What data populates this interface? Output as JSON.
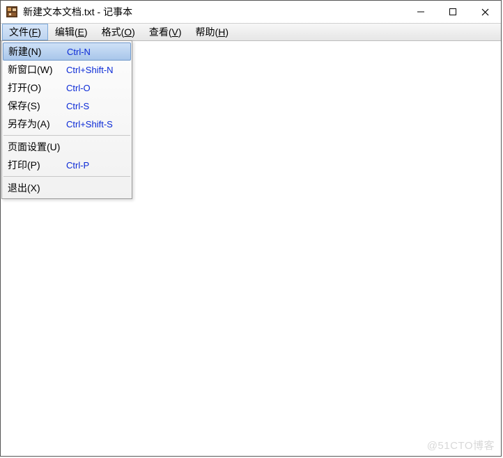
{
  "window": {
    "title": "新建文本文档.txt - 记事本"
  },
  "menubar": {
    "items": [
      {
        "pre": "文件(",
        "mn": "F",
        "post": ")",
        "active": true
      },
      {
        "pre": "编辑(",
        "mn": "E",
        "post": ")",
        "active": false
      },
      {
        "pre": "格式(",
        "mn": "O",
        "post": ")",
        "active": false
      },
      {
        "pre": "查看(",
        "mn": "V",
        "post": ")",
        "active": false
      },
      {
        "pre": "帮助(",
        "mn": "H",
        "post": ")",
        "active": false
      }
    ]
  },
  "file_menu": {
    "items": [
      {
        "label": "新建(N)",
        "accel": "Ctrl-N",
        "selected": true
      },
      {
        "label": "新窗口(W)",
        "accel": "Ctrl+Shift-N",
        "selected": false
      },
      {
        "label": "打开(O)",
        "accel": "Ctrl-O",
        "selected": false
      },
      {
        "label": "保存(S)",
        "accel": "Ctrl-S",
        "selected": false
      },
      {
        "label": "另存为(A)",
        "accel": "Ctrl+Shift-S",
        "selected": false
      },
      {
        "sep": true
      },
      {
        "label": "页面设置(U)",
        "accel": "",
        "selected": false
      },
      {
        "label": "打印(P)",
        "accel": "Ctrl-P",
        "selected": false
      },
      {
        "sep": true
      },
      {
        "label": "退出(X)",
        "accel": "",
        "selected": false
      }
    ]
  },
  "watermark": "@51CTO博客"
}
